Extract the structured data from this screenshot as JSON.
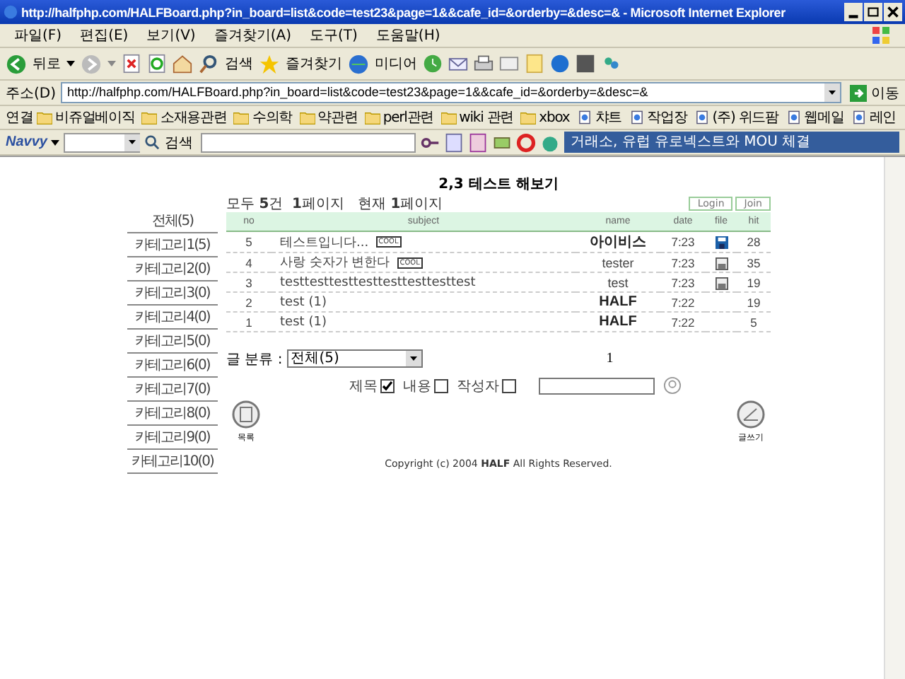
{
  "window": {
    "title": "http://halfphp.com/HALFBoard.php?in_board=list&code=test23&page=1&&cafe_id=&orderby=&desc=& - Microsoft Internet Explorer"
  },
  "menu": [
    "파일(F)",
    "편집(E)",
    "보기(V)",
    "즐겨찾기(A)",
    "도구(T)",
    "도움말(H)"
  ],
  "toolbar": {
    "back": "뒤로",
    "search": "검색",
    "favorites": "즐겨찾기",
    "media": "미디어"
  },
  "address": {
    "label": "주소(D)",
    "url": "http://halfphp.com/HALFBoard.php?in_board=list&code=test23&page=1&&cafe_id=&orderby=&desc=&",
    "go": "이동"
  },
  "links": {
    "label": "연결",
    "items": [
      {
        "label": "비쥬얼베이직",
        "kind": "folder"
      },
      {
        "label": "소재용관련",
        "kind": "folder"
      },
      {
        "label": "수의학",
        "kind": "folder"
      },
      {
        "label": "약관련",
        "kind": "folder"
      },
      {
        "label": "perl관련",
        "kind": "folder"
      },
      {
        "label": "wiki 관련",
        "kind": "folder"
      },
      {
        "label": "xbox",
        "kind": "folder"
      },
      {
        "label": "챠트",
        "kind": "page"
      },
      {
        "label": "작업장",
        "kind": "page"
      },
      {
        "label": "(주) 위드팜",
        "kind": "page"
      },
      {
        "label": "웹메일",
        "kind": "page"
      },
      {
        "label": "레인",
        "kind": "page"
      }
    ]
  },
  "navvy": {
    "brand": "Navvy",
    "search": "검색",
    "news": "거래소, 유럽 유로넥스트와 MOU 체결"
  },
  "board": {
    "title": "2,3 테스트 해보기",
    "summary": "모두 **5**건  **1**페이지   현재 **1**페이지",
    "buttons": [
      "Login",
      "Join"
    ],
    "all_category": "전체(5)",
    "categories": [
      "카테고리1(5)",
      "카테고리2(0)",
      "카테고리3(0)",
      "카테고리4(0)",
      "카테고리5(0)",
      "카테고리6(0)",
      "카테고리7(0)",
      "카테고리8(0)",
      "카테고리9(0)",
      "카테고리10(0)"
    ],
    "columns": [
      "no",
      "subject",
      "name",
      "date",
      "file",
      "hit"
    ],
    "rows": [
      {
        "no": "5",
        "subject": "테스트입니다...",
        "badge": "COOL",
        "name": "아이비스",
        "name_bold": true,
        "date": "7:23",
        "file": {
          "kind": "disk-blue"
        },
        "hit": "28"
      },
      {
        "no": "4",
        "subject": "사랑 숫자가 변한다",
        "badge": "COOL",
        "name": "tester",
        "name_bold": false,
        "date": "7:23",
        "file": {
          "kind": "disk"
        },
        "hit": "35"
      },
      {
        "no": "3",
        "subject": "testtesttesttesttesttesttesttest",
        "name": "test",
        "name_bold": false,
        "date": "7:23",
        "file": {
          "kind": "disk"
        },
        "hit": "19"
      },
      {
        "no": "2",
        "subject": "test",
        "comments": "(1)",
        "name": "HALF",
        "name_bold": true,
        "date": "7:22",
        "hit": "19"
      },
      {
        "no": "1",
        "subject": "test",
        "comments": "(1)",
        "name": "HALF",
        "name_bold": true,
        "date": "7:22",
        "hit": "5"
      }
    ],
    "filter": {
      "label": "글 분류 :",
      "value": "전체(5)"
    },
    "pagination": "1",
    "search_options": [
      {
        "label": "제목",
        "checked": true
      },
      {
        "label": "내용",
        "checked": false
      },
      {
        "label": "작성자",
        "checked": false
      }
    ],
    "list_button": "목록",
    "write_button": "글쓰기",
    "copyright": "Copyright (c) 2004 **HALF** All Rights Reserved."
  }
}
